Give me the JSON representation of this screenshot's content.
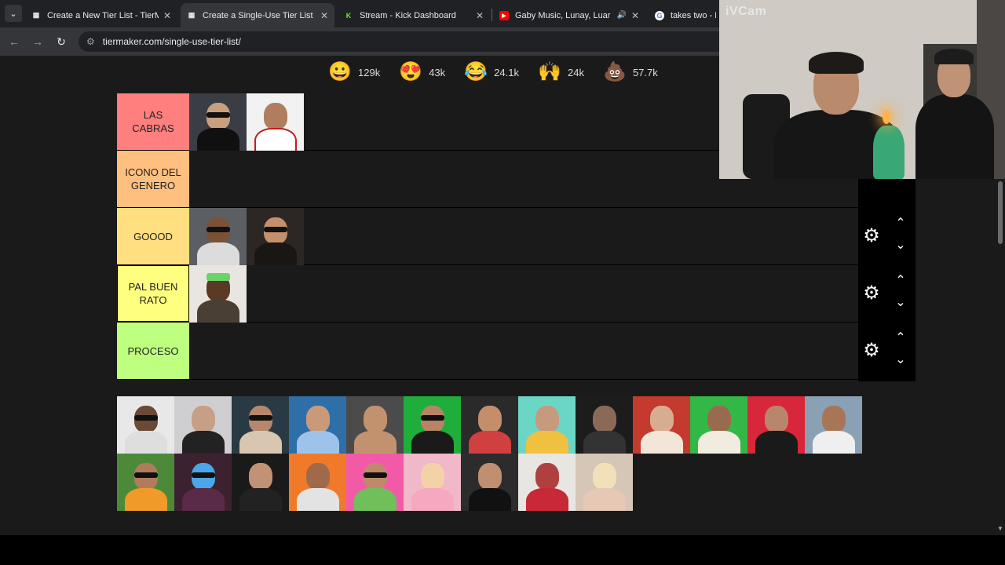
{
  "browser": {
    "tabs": [
      {
        "title": "Create a New Tier List - TierMaker",
        "favicon": "tiermaker",
        "active": false
      },
      {
        "title": "Create a Single-Use Tier List (Pr",
        "favicon": "tiermaker",
        "active": true
      },
      {
        "title": "Stream - Kick Dashboard",
        "favicon": "kick",
        "active": false
      },
      {
        "title": "Gaby Music, Lunay, Luar La",
        "favicon": "youtube",
        "active": false,
        "audio": true
      },
      {
        "title": "takes two - Bu",
        "favicon": "google",
        "active": false
      }
    ],
    "url": "tiermaker.com/single-use-tier-list/"
  },
  "reactions": [
    {
      "emoji": "😀",
      "count": "129k"
    },
    {
      "emoji": "😍",
      "count": "43k"
    },
    {
      "emoji": "😂",
      "count": "24.1k"
    },
    {
      "emoji": "🙌",
      "count": "24k"
    },
    {
      "emoji": "💩",
      "count": "57.7k"
    }
  ],
  "tiers": [
    {
      "label": "LAS CABRAS",
      "color": "#ff7f7f",
      "items": 2
    },
    {
      "label": "ICONO DEL GENERO",
      "color": "#ffbf7f",
      "items": 0
    },
    {
      "label": "GOOOD",
      "color": "#ffdf7f",
      "items": 2
    },
    {
      "label": "PAL BUEN RATO",
      "color": "#ffff7f",
      "items": 1,
      "selected": true
    },
    {
      "label": "PROCESO",
      "color": "#bfff7f",
      "items": 0
    }
  ],
  "webcam": {
    "label": "iVCam"
  }
}
